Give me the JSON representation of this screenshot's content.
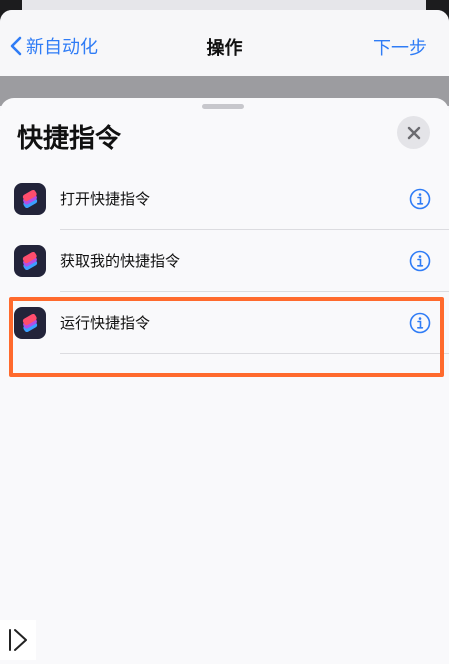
{
  "navbar": {
    "back_label": "新自动化",
    "title": "操作",
    "next_label": "下一步"
  },
  "sheet": {
    "title": "快捷指令",
    "items": [
      {
        "label": "打开快捷指令",
        "icon": "shortcuts-app-icon",
        "highlighted": false
      },
      {
        "label": "获取我的快捷指令",
        "icon": "shortcuts-app-icon",
        "highlighted": false
      },
      {
        "label": "运行快捷指令",
        "icon": "shortcuts-app-icon",
        "highlighted": true
      }
    ]
  },
  "colors": {
    "accent": "#2f7cf6",
    "highlight": "#ff6a2d"
  }
}
